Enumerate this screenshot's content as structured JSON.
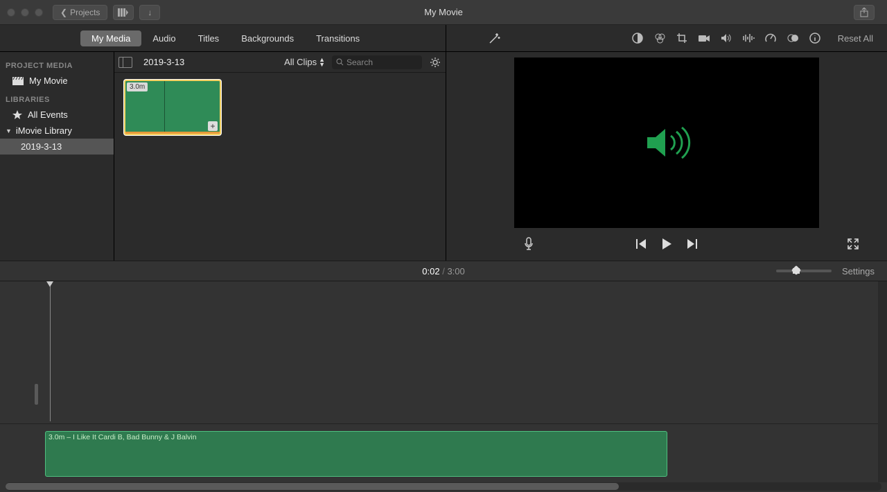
{
  "titlebar": {
    "back_label": "Projects",
    "title": "My Movie"
  },
  "tabs": {
    "my_media": "My Media",
    "audio": "Audio",
    "titles": "Titles",
    "backgrounds": "Backgrounds",
    "transitions": "Transitions"
  },
  "adjust": {
    "reset": "Reset All"
  },
  "sidebar": {
    "project_media": "PROJECT MEDIA",
    "project_name": "My Movie",
    "libraries": "LIBRARIES",
    "all_events": "All Events",
    "library": "iMovie Library",
    "event": "2019-3-13"
  },
  "browser": {
    "event_name": "2019-3-13",
    "filter": "All Clips",
    "search_placeholder": "Search",
    "clip_duration": "3.0m"
  },
  "playback": {
    "current": "0:02",
    "sep": "/",
    "total": "3:00"
  },
  "timeline": {
    "settings": "Settings",
    "clip_label": "3.0m – I Like It Cardi B, Bad Bunny & J Balvin"
  }
}
